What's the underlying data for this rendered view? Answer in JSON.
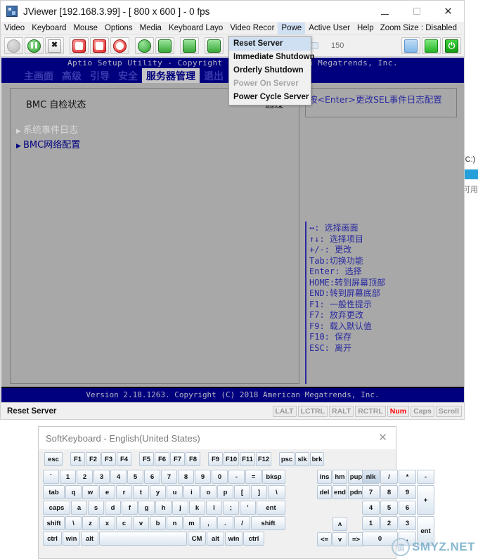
{
  "explorer": {
    "drive_label": "(C:)",
    "avail_label": "可用"
  },
  "jviewer": {
    "title": "JViewer [192.168.3.99] - [ 800 x 600 ] - 0 fps",
    "window_buttons": {
      "minimize": "─",
      "maximize": "□",
      "close": "✕"
    },
    "menus": [
      {
        "label": "Video"
      },
      {
        "label": "Keyboard"
      },
      {
        "label": "Mouse"
      },
      {
        "label": "Options"
      },
      {
        "label": "Media"
      },
      {
        "label": "Keyboard Layo"
      },
      {
        "label": "Video Recor"
      },
      {
        "label": "Powe"
      },
      {
        "label": "Active User"
      },
      {
        "label": "Help"
      }
    ],
    "zoom_size": "Zoom Size : Disabled",
    "toolbar": {
      "slider_value": "150",
      "buttons": [
        {
          "name": "play-button",
          "glyph": "▶",
          "state": "disabled"
        },
        {
          "name": "pause-button",
          "glyph": "‖",
          "state": "enabled"
        },
        {
          "name": "fullscreen-button",
          "glyph": "✖",
          "state": "enabled"
        },
        {
          "name": "drive-redirect-button",
          "glyph": "",
          "state": "enabled"
        },
        {
          "name": "save-button",
          "glyph": "",
          "state": "enabled"
        },
        {
          "name": "cdrom-button",
          "glyph": "",
          "state": "enabled"
        },
        {
          "name": "mouse-button",
          "glyph": "",
          "state": "enabled"
        },
        {
          "name": "keyboard-button",
          "glyph": "",
          "state": "enabled"
        },
        {
          "name": "softkeyboard-button",
          "glyph": "",
          "state": "enabled"
        },
        {
          "name": "chat-button",
          "glyph": "",
          "state": "enabled"
        }
      ],
      "right_buttons": [
        {
          "name": "active-user-button"
        },
        {
          "name": "console-button"
        },
        {
          "name": "power-button",
          "glyph": "⏻"
        }
      ]
    },
    "power_menu": {
      "items": [
        {
          "label": "Reset Server",
          "selected": true,
          "disabled": false
        },
        {
          "label": "Immediate Shutdown",
          "selected": false,
          "disabled": false
        },
        {
          "label": "Orderly Shutdown",
          "selected": false,
          "disabled": false
        },
        {
          "label": "Power On Server",
          "selected": false,
          "disabled": true
        },
        {
          "label": "Power Cycle Server",
          "selected": false,
          "disabled": false
        }
      ]
    },
    "status": {
      "text": "Reset Server",
      "indicators": [
        {
          "label": "LALT",
          "active": false
        },
        {
          "label": "LCTRL",
          "active": false
        },
        {
          "label": "RALT",
          "active": false
        },
        {
          "label": "RCTRL",
          "active": false
        },
        {
          "label": "Num",
          "active": true
        },
        {
          "label": "Caps",
          "active": false
        },
        {
          "label": "Scroll",
          "active": false
        }
      ]
    }
  },
  "bios": {
    "header_title": "Aptio Setup Utility - Copyright (C) 2018 American Megatrends, Inc.",
    "tabs": [
      {
        "label": "主画面",
        "active": false
      },
      {
        "label": "高级",
        "active": false
      },
      {
        "label": "引导",
        "active": false
      },
      {
        "label": "安全",
        "active": false
      },
      {
        "label": "服务器管理",
        "active": true
      },
      {
        "label": "退出",
        "active": false
      }
    ],
    "bmc_row": {
      "label": "BMC 自检状态",
      "value": "通过"
    },
    "submenus": [
      {
        "label": "系统事件日志",
        "highlighted": true
      },
      {
        "label": "BMC网络配置",
        "highlighted": false
      }
    ],
    "help_text": "按<Enter>更改SEL事件日志配置",
    "key_help": [
      "↔: 选择画面",
      "↑↓: 选择项目",
      "+/-: 更改",
      "Tab:切换功能",
      "Enter: 选择",
      "HOME:转到屏幕顶部",
      "END:转到屏幕底部",
      "F1: 一般性提示",
      "F7: 放弃更改",
      "F9: 载入默认值",
      "F10: 保存",
      "ESC: 离开"
    ],
    "footer": "Version 2.18.1263. Copyright (C) 2018 American Megatrends, Inc."
  },
  "softkeyboard": {
    "title": "SoftKeyboard - English(United States)",
    "close_glyph": "✕",
    "fn_groups": [
      [
        "esc"
      ],
      [
        "F1",
        "F2",
        "F3",
        "F4"
      ],
      [
        "F5",
        "F6",
        "F7",
        "F8"
      ],
      [
        "F9",
        "F10",
        "F11",
        "F12"
      ],
      [
        "psc",
        "slk",
        "brk"
      ]
    ],
    "main_rows": [
      [
        "`",
        "1",
        "2",
        "3",
        "4",
        "5",
        "6",
        "7",
        "8",
        "9",
        "0",
        "-",
        "=",
        "bksp"
      ],
      [
        "tab",
        "q",
        "w",
        "e",
        "r",
        "t",
        "y",
        "u",
        "i",
        "o",
        "p",
        "[",
        "]",
        "\\"
      ],
      [
        "caps",
        "a",
        "s",
        "d",
        "f",
        "g",
        "h",
        "j",
        "k",
        "l",
        ";",
        "'",
        "ent"
      ],
      [
        "shift",
        "\\",
        "z",
        "x",
        "c",
        "v",
        "b",
        "n",
        "m",
        ",",
        ".",
        "/",
        "shift"
      ],
      [
        "ctrl",
        "win",
        "alt",
        "",
        "CM",
        "alt",
        "win",
        "ctrl"
      ]
    ],
    "nav_rows": [
      [
        "ins",
        "hm",
        "pup"
      ],
      [
        "del",
        "end",
        "pdn"
      ]
    ],
    "arrow_up": "ʌ",
    "arrow_rows": [
      [
        "<=",
        "v",
        "=>"
      ]
    ],
    "numpad": [
      [
        "nlk",
        "/",
        "*",
        "-"
      ],
      [
        "7",
        "8",
        "9",
        "+"
      ],
      [
        "4",
        "5",
        "6"
      ],
      [
        "1",
        "2",
        "3",
        "ent"
      ],
      [
        "0",
        "."
      ]
    ],
    "numlock_selected": true
  },
  "watermark": {
    "circle_char": "值",
    "text": "SMYZ.NET"
  }
}
